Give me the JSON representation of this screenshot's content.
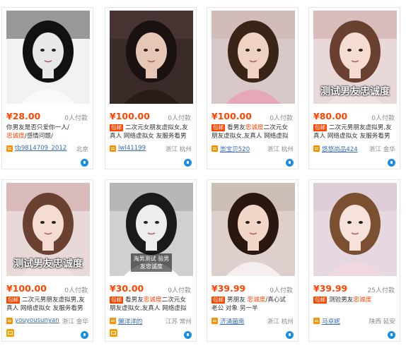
{
  "listings": [
    {
      "price": "¥28.00",
      "paid": "0人付款",
      "badge": "",
      "title_line1": [
        {
          "t": "你男友是否只爱你一人/",
          "h": false
        }
      ],
      "title_line2": [
        {
          "t": "忠诚度",
          "h": true
        },
        {
          "t": "/感情问题/",
          "h": false
        }
      ],
      "shop": "tb9814709_2012",
      "location": "北京",
      "caption": "",
      "tag": "",
      "icon": "shop-icon",
      "show_wangwang": false,
      "colors": {
        "bg": "#f2f2f2",
        "hair": "#111",
        "skin": "#e8e8e8",
        "shirt": "#fafafa",
        "scene": "#2a2a2a"
      }
    },
    {
      "price": "¥100.00",
      "paid": "0人付款",
      "badge": "包邮",
      "title_line1": [
        {
          "t": "二次元女朋友虚拟女,友",
          "h": false
        }
      ],
      "title_line2": [
        {
          "t": "真人 网络虚拟女 友服务看男",
          "h": false
        }
      ],
      "shop": "lwl41199",
      "location": "浙江 杭州",
      "caption": "",
      "tag": "",
      "icon": "shop-icon",
      "show_wangwang": false,
      "colors": {
        "bg": "#3a2a28",
        "hair": "#1a1210",
        "skin": "#e6c6b4",
        "shirt": "#2a1a18",
        "scene": "#5a4040"
      }
    },
    {
      "price": "¥100.00",
      "paid": "0人付款",
      "badge": "包邮",
      "title_line1": [
        {
          "t": "看男友",
          "h": false
        },
        {
          "t": "忠诚度",
          "h": true
        },
        {
          "t": "二次元女",
          "h": false
        }
      ],
      "title_line2": [
        {
          "t": "朋友虚拟女,友真人 网络虚拟",
          "h": false
        }
      ],
      "shop": "崇宝贝520",
      "location": "浙江 杭州",
      "caption": "",
      "tag": "",
      "icon": "shop-icon",
      "show_wangwang": false,
      "colors": {
        "bg": "#d8c8c8",
        "hair": "#3a2418",
        "skin": "#f0d2c2",
        "shirt": "#e6a8b8",
        "scene": "#c8b0a8"
      }
    },
    {
      "price": "¥80.00",
      "paid": "0人付款",
      "badge": "包邮",
      "title_line1": [
        {
          "t": "二次元男朋友虚拟男,友",
          "h": false
        }
      ],
      "title_line2": [
        {
          "t": "真人 网络虚拟女 友服务看男",
          "h": false
        }
      ],
      "shop": "悠悠尚品424",
      "location": "浙江 金华",
      "caption": "测试男友忠诚度",
      "tag": "",
      "icon": "shop-icon",
      "show_wangwang": false,
      "colors": {
        "bg": "#e8d8d8",
        "hair": "#6a4030",
        "skin": "#f4dcd0",
        "shirt": "#f0e0e0",
        "scene": "#c89a98"
      }
    },
    {
      "price": "¥100.00",
      "paid": "0人付款",
      "badge": "包邮",
      "title_line1": [
        {
          "t": "二次元男朋友虚拟男,友",
          "h": false
        }
      ],
      "title_line2": [
        {
          "t": "真人 网络虚拟女 友服务看男",
          "h": false
        }
      ],
      "shop": "youyousunyan",
      "location": "浙江 金华",
      "caption": "测试男友忠诚度",
      "tag": "",
      "icon": "ww-icon",
      "show_wangwang": true,
      "colors": {
        "bg": "#e8d8d8",
        "hair": "#6a4030",
        "skin": "#f4dcd0",
        "shirt": "#f0e0e0",
        "scene": "#c89a98"
      }
    },
    {
      "price": "¥30.00",
      "paid": "0人付款",
      "badge": "包邮",
      "title_line1": [
        {
          "t": "看男友",
          "h": false
        },
        {
          "t": "忠诚度",
          "h": true
        },
        {
          "t": "二次元女",
          "h": false
        }
      ],
      "title_line2": [
        {
          "t": "朋友虚拟女,友真人 网络虚拟",
          "h": false
        }
      ],
      "shop": "懒洋洋的",
      "location": "江苏 常州",
      "caption": "",
      "tag": "淘男测试 验男友忠诚度",
      "icon": "ww-icon",
      "show_wangwang": true,
      "colors": {
        "bg": "#d0d0d0",
        "hair": "#1a1a1a",
        "skin": "#ededed",
        "shirt": "#ffffff",
        "scene": "#9a9a9a"
      }
    },
    {
      "price": "¥39.99",
      "paid": "0人付款",
      "badge": "包邮",
      "title_line1": [
        {
          "t": "男朋友 ",
          "h": false
        },
        {
          "t": "忠诚度",
          "h": true
        },
        {
          "t": "/真心试",
          "h": false
        }
      ],
      "title_line2": [
        {
          "t": "老公 对象 另一半",
          "h": false
        }
      ],
      "shop": "济涌菌南",
      "location": "浙江 杭州",
      "caption": "",
      "tag": "",
      "icon": "shop-icon",
      "show_wangwang": false,
      "colors": {
        "bg": "#ddd0cc",
        "hair": "#2a1810",
        "skin": "#f2d6c8",
        "shirt": "#f6eeee",
        "scene": "#bba8a0"
      }
    },
    {
      "price": "¥39.99",
      "paid": "25人付款",
      "badge": "包邮",
      "title_line1": [
        {
          "t": "测验男友",
          "h": false
        },
        {
          "t": "忠诚度",
          "h": true
        }
      ],
      "title_line2": [],
      "shop": "马卓妮",
      "location": "陕西 延安",
      "caption": "",
      "tag": "",
      "icon": "shop-icon",
      "show_wangwang": false,
      "colors": {
        "bg": "#e6d8e0",
        "hair": "#7a5030",
        "skin": "#f6e2da",
        "shirt": "#f0d8e0",
        "scene": "#d8c0cc"
      }
    }
  ]
}
